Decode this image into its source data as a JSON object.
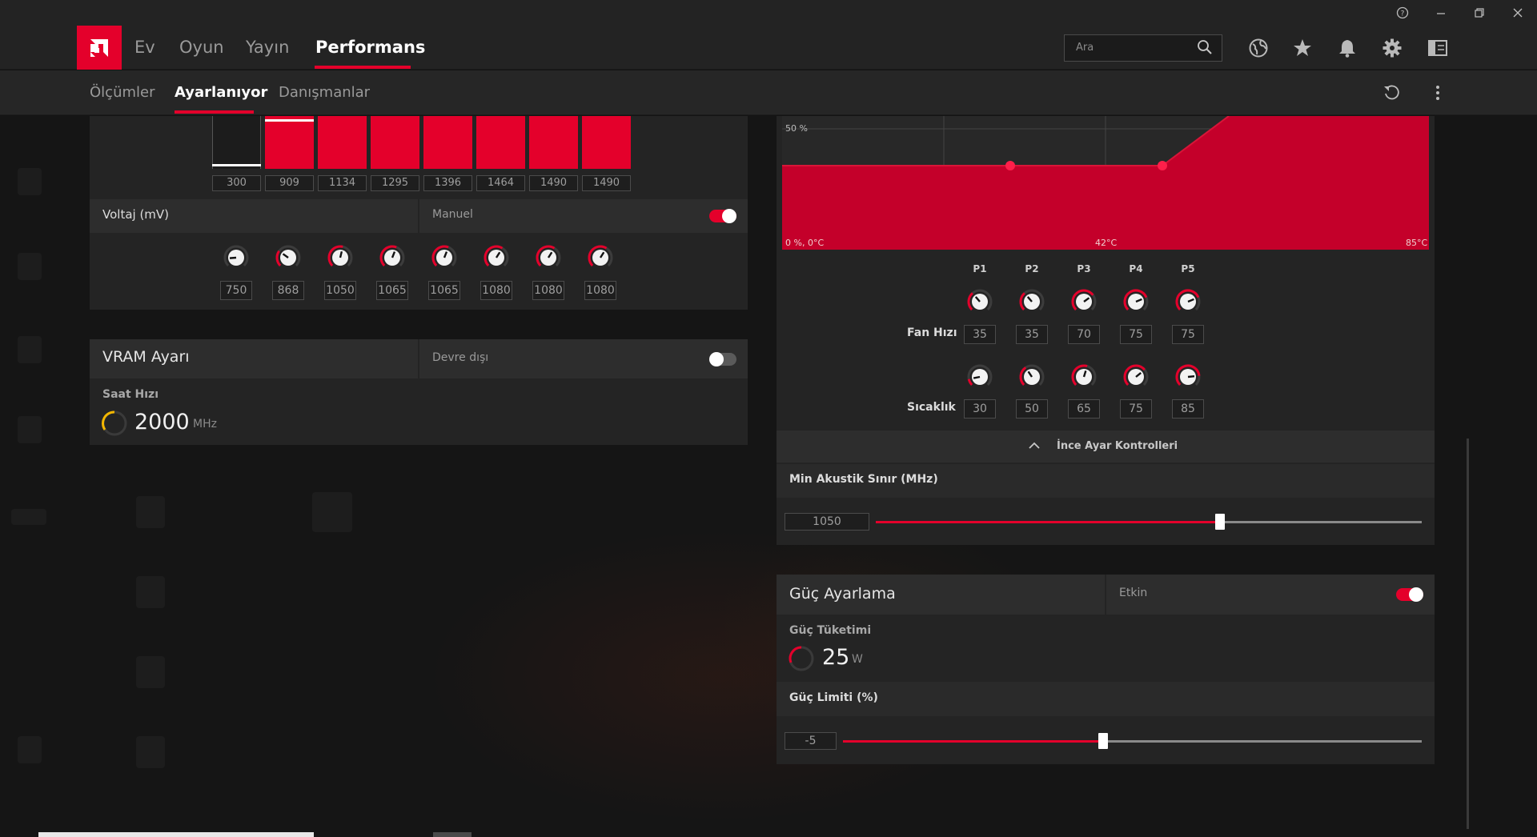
{
  "window": {
    "help_icon": "question-circle-icon",
    "minimize_icon": "minimize-icon",
    "restore_icon": "restore-icon",
    "close_icon": "close-icon"
  },
  "nav": {
    "tabs": [
      "Ev",
      "Oyun",
      "Yayın",
      "Performans"
    ],
    "active_tab": "Performans",
    "search_placeholder": "Ara",
    "icons": [
      "globe-icon",
      "star-icon",
      "bell-icon",
      "gear-icon",
      "sidebar-layout-icon"
    ]
  },
  "subnav": {
    "tabs": [
      "Ölçümler",
      "Ayarlanıyor",
      "Danışmanlar"
    ],
    "active_tab": "Ayarlanıyor",
    "reset_icon": "reset-icon",
    "more_icon": "more-vertical-icon"
  },
  "frequency": {
    "values": [
      "300",
      "909",
      "1134",
      "1295",
      "1396",
      "1464",
      "1490",
      "1490"
    ]
  },
  "voltage": {
    "title": "Voltaj (mV)",
    "mode": "Manuel",
    "enabled": true,
    "values": [
      "750",
      "868",
      "1050",
      "1065",
      "1065",
      "1080",
      "1080",
      "1080"
    ],
    "fractions": [
      0.15,
      0.3,
      0.55,
      0.58,
      0.58,
      0.62,
      0.62,
      0.62
    ]
  },
  "vram": {
    "title": "VRAM Ayarı",
    "mode": "Devre dışı",
    "enabled": false,
    "clock_label": "Saat Hızı",
    "clock_value": "2000",
    "clock_unit": "MHz"
  },
  "fan_curve": {
    "y_label_mid": "50 %",
    "origin_label": "0 %, 0°C",
    "x_label_mid": "42°C",
    "x_label_max": "85°C",
    "accent": "#e4002b"
  },
  "fan_points": {
    "columns": [
      "P1",
      "P2",
      "P3",
      "P4",
      "P5"
    ],
    "speed_label": "Fan Hızı",
    "speed_values": [
      "35",
      "35",
      "70",
      "75",
      "75"
    ],
    "temp_label": "Sıcaklık",
    "temp_values": [
      "30",
      "50",
      "65",
      "75",
      "85"
    ]
  },
  "fine_tune": {
    "toggle_label": "İnce Ayar Kontrolleri",
    "min_acoustic_label": "Min Akustik Sınır (MHz)",
    "min_acoustic_value": "1050",
    "min_acoustic_fraction": 0.63
  },
  "power": {
    "title": "Güç Ayarlama",
    "mode": "Etkin",
    "enabled": true,
    "consumption_label": "Güç Tüketimi",
    "consumption_value": "25",
    "consumption_unit": "W",
    "limit_label": "Güç Limiti (%)",
    "limit_value": "-5",
    "limit_fraction": 0.45
  }
}
